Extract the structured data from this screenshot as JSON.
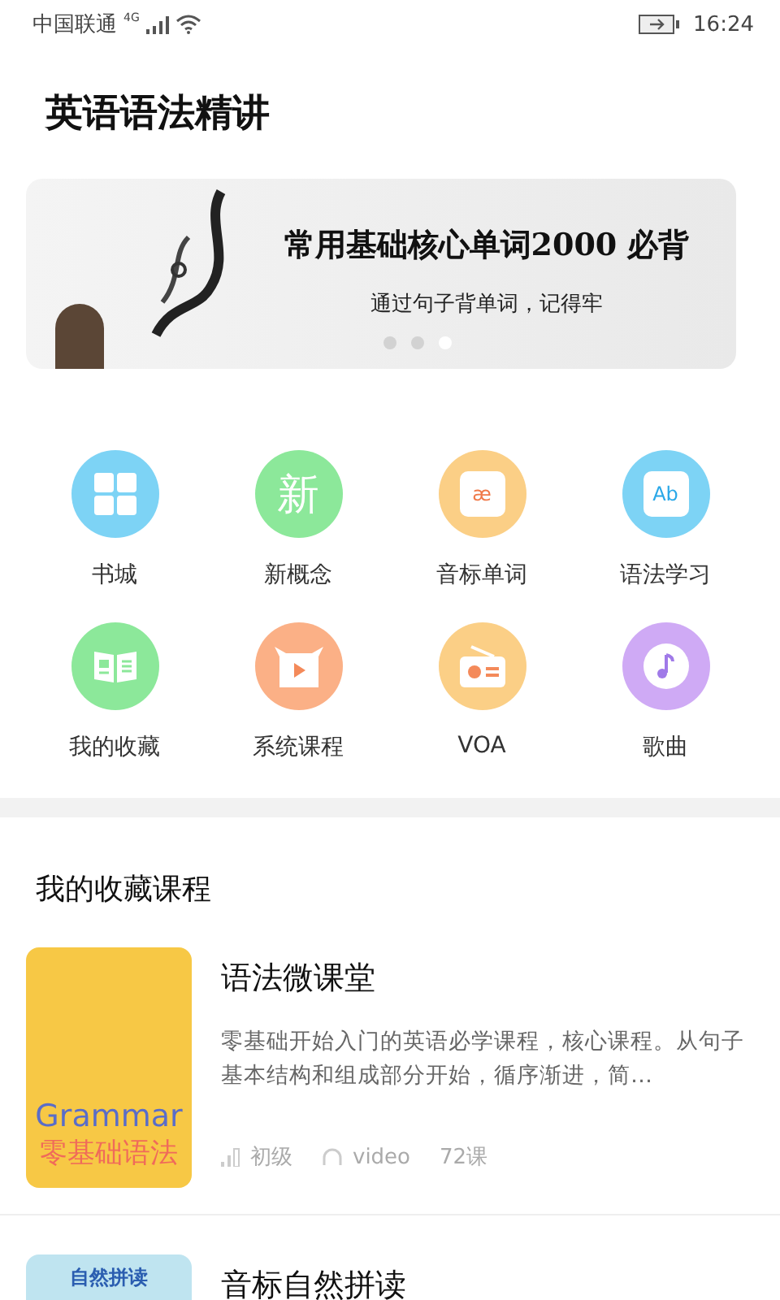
{
  "status_bar": {
    "carrier": "中国联通",
    "network": "4G",
    "time": "16:24"
  },
  "title": "英语语法精讲",
  "banner": {
    "headline": "常用基础核心单词2000 必背",
    "subtitle": "通过句子背单词，记得牢",
    "dots": [
      {
        "selected": false
      },
      {
        "selected": false
      },
      {
        "selected": true
      }
    ]
  },
  "shortcuts": [
    {
      "label": "书城",
      "kind": "grid",
      "color": "#7dd3f5"
    },
    {
      "label": "新概念",
      "kind": "glyph",
      "glyph": "新",
      "color": "#8ce89a"
    },
    {
      "label": "音标单词",
      "kind": "tile",
      "glyph": "æ",
      "color": "#fbcf86"
    },
    {
      "label": "语法学习",
      "kind": "tile",
      "glyph": "Ab",
      "color": "#7dd3f5"
    },
    {
      "label": "我的收藏",
      "kind": "book",
      "color": "#8ce89a"
    },
    {
      "label": "系统课程",
      "kind": "video",
      "color": "#fbb086"
    },
    {
      "label": "VOA",
      "kind": "radio",
      "color": "#fbcf86"
    },
    {
      "label": "歌曲",
      "kind": "music",
      "color": "#cfaaf5"
    }
  ],
  "section_title": "我的收藏课程",
  "courses": [
    {
      "title": "语法微课堂",
      "description": "零基础开始入门的英语必学课程，核心课程。从句子基本结构和组成部分开始，循序渐进，简…",
      "level": "初级",
      "media": "video",
      "lessons": "72课",
      "thumb_lines": [
        "Grammar",
        "零基础语法"
      ],
      "color": "#f7c845"
    },
    {
      "title": "音标自然拼读",
      "thumb_lines": [
        "自然拼读"
      ],
      "color": "#bfe4f0"
    }
  ]
}
